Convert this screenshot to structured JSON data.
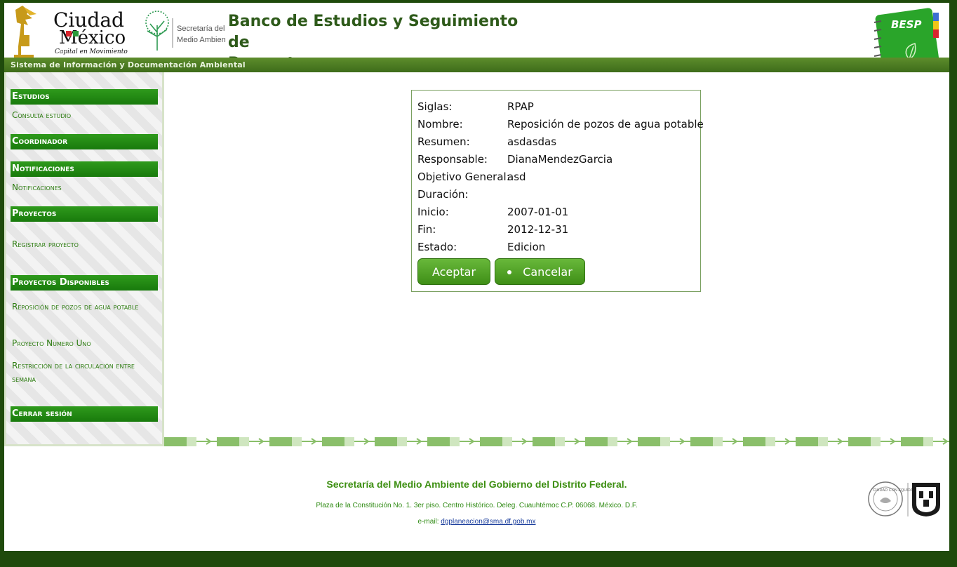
{
  "header": {
    "cdmx_logo_text_1": "Ciudad",
    "cdmx_logo_text_2": "México",
    "cdmx_logo_tagline": "Capital en Movimiento",
    "sma_logo_line1": "Secretaría del",
    "sma_logo_line2": "Medio Ambiente",
    "title_line1": "Banco de Estudios y Seguimiento de",
    "title_line2": "Proyectos",
    "besp_badge": "BESP",
    "subtitle": "Sistema de Información y Documentación Ambiental"
  },
  "sidebar": {
    "estudios": {
      "title": "Estudios",
      "items": [
        "Consulta estudio"
      ]
    },
    "coordinador": {
      "title": "Coordinador"
    },
    "notificaciones": {
      "title": "Notificaciones",
      "items": [
        "Notificaciones"
      ]
    },
    "proyectos": {
      "title": "Proyectos",
      "items": [
        "Registrar proyecto"
      ]
    },
    "disponibles": {
      "title": "Proyectos Disponibles",
      "items": [
        "Reposición de pozos de agua potable",
        "Proyecto Numero Uno",
        "Restricción de la circulación entre semana"
      ]
    },
    "cerrar": {
      "title": "Cerrar sesión"
    }
  },
  "detail": {
    "fields": [
      {
        "label": "Siglas:",
        "value": "RPAP"
      },
      {
        "label": "Nombre:",
        "value": "Reposición de pozos de agua potable"
      },
      {
        "label": "Resumen:",
        "value": "asdasdas"
      },
      {
        "label": "Responsable:",
        "value": "DianaMendezGarcia"
      },
      {
        "label": "Objetivo General:",
        "value": "asd"
      },
      {
        "label": "Duración:",
        "value": ""
      },
      {
        "label": "Inicio:",
        "value": "2007-01-01"
      },
      {
        "label": "Fin:",
        "value": "2012-12-31"
      },
      {
        "label": "Estado:",
        "value": "Edicion"
      }
    ],
    "accept_label": "Aceptar",
    "cancel_label": "Cancelar"
  },
  "footer": {
    "title": "Secretaría del Medio Ambiente del Gobierno del Distrito Federal.",
    "address": "Plaza de la Constitución No. 1. 3er piso. Centro Histórico. Deleg. Cuauhtémoc C.P. 06068. México. D.F.",
    "email_label": "e-mail: ",
    "email": "dgplaneacion@sma.df.gob.mx",
    "seal_text": "CIUDAD CON EQUIDAD"
  },
  "colors": {
    "brand_green": "#187a0c",
    "header_bar": "#4f7e24",
    "link_green": "#2e7d12",
    "title_green": "#2e5a1a",
    "background": "#1f4a0c"
  }
}
